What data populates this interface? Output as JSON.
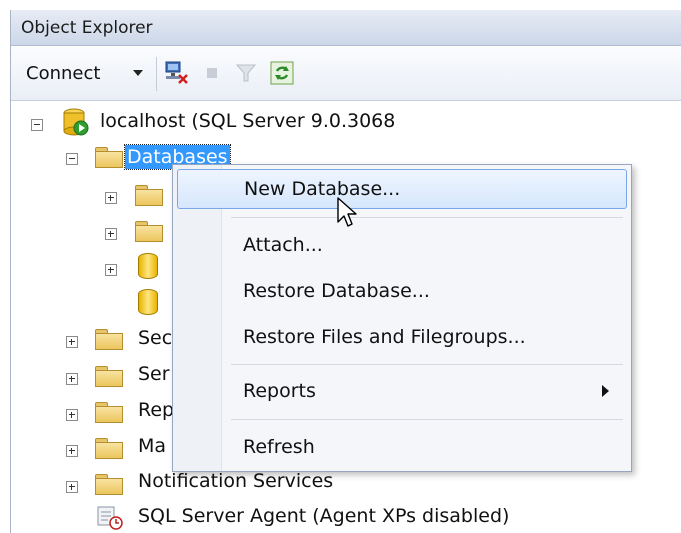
{
  "window": {
    "title": "Object Explorer"
  },
  "toolbar": {
    "connect_label": "Connect",
    "icons": [
      "connect-server-icon",
      "disconnect-icon",
      "stop-icon",
      "filter-icon",
      "refresh-icon"
    ]
  },
  "tree": {
    "server": "localhost (SQL Server 9.0.3068",
    "databases": "Databases",
    "security": "Sec",
    "server_objects": "Ser",
    "replication": "Rep",
    "management": "Ma",
    "notification_services": "Notification Services",
    "sql_server_agent": "SQL Server Agent (Agent XPs disabled)"
  },
  "context_menu": {
    "new_database": "New Database...",
    "attach": "Attach...",
    "restore_database": "Restore Database...",
    "restore_files": "Restore Files and Filegroups...",
    "reports": "Reports",
    "refresh": "Refresh"
  },
  "colors": {
    "selection": "#3399ff",
    "menu_hover_border": "#7aa7e8",
    "titlebar": "#ccd7e8"
  }
}
